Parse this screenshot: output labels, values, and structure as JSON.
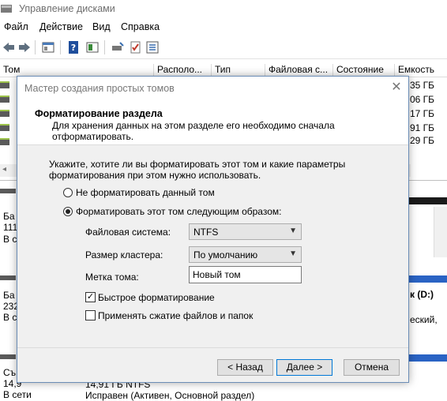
{
  "window": {
    "title": "Управление дисками"
  },
  "menu": [
    "Файл",
    "Действие",
    "Вид",
    "Справка"
  ],
  "list": {
    "columns": [
      "Том",
      "Располо...",
      "Тип",
      "Файловая с...",
      "Состояние",
      "Емкость"
    ],
    "capacities": [
      "35 ГБ",
      "06 ГБ",
      "17 ГБ",
      "91 ГБ",
      "29 ГБ"
    ]
  },
  "lower": {
    "disk0": {
      "l1": "Ба",
      "l2": "111",
      "l3": "В с"
    },
    "disk1": {
      "l1": "Ба",
      "l2": "232",
      "l3": "В с",
      "vol_label": "к (D:)",
      "vol_detail": "еский,"
    },
    "disk2": {
      "l1": "Съ",
      "l2": "14,9",
      "l3": "В сети",
      "vol_size": "14,91 ГБ NTFS",
      "vol_status": "Исправен (Активен, Основной раздел)"
    }
  },
  "dialog": {
    "title": "Мастер создания простых томов",
    "header_title": "Форматирование раздела",
    "header_desc": "Для хранения данных на этом разделе его необходимо сначала отформатировать.",
    "intro": "Укажите, хотите ли вы форматировать этот том и какие параметры форматирования при этом нужно использовать.",
    "radio_no": "Не форматировать данный том",
    "radio_yes": "Форматировать этот том следующим образом:",
    "fs_label": "Файловая система:",
    "fs_value": "NTFS",
    "cluster_label": "Размер кластера:",
    "cluster_value": "По умолчанию",
    "volume_label_label": "Метка тома:",
    "volume_label_value": "Новый том",
    "quick_format": "Быстрое форматирование",
    "quick_format_checked": true,
    "compress": "Применять сжатие файлов и папок",
    "compress_checked": false,
    "back": "< Назад",
    "next": "Далее >",
    "cancel": "Отмена"
  }
}
